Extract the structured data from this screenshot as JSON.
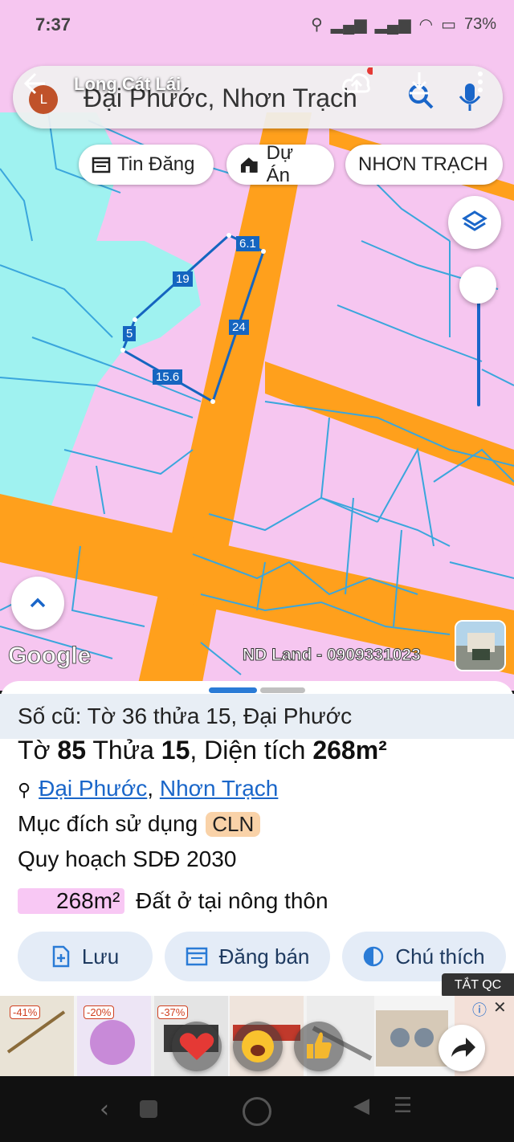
{
  "status_bar": {
    "time": "7:37",
    "battery": "73%"
  },
  "header": {
    "overlay_title": "Long Cát Lái",
    "avatar_letter": "L",
    "search_query": "Đại Phước, Nhơn Trạch"
  },
  "chips": [
    {
      "label": "Tin Đăng",
      "icon": "calendar-icon"
    },
    {
      "label": "Dự Án",
      "icon": "house-icon"
    },
    {
      "label": "NHƠN TRẠCH"
    }
  ],
  "plot_dimensions": [
    "6.1",
    "19",
    "24",
    "5",
    "15.6"
  ],
  "map_labels": {
    "google": "Google",
    "watermark": "ND Land - 0909331023"
  },
  "sheet": {
    "old_parcel": "Số cũ: Tờ 36 thửa 15, Đại Phước",
    "parcel_prefix": "Tờ ",
    "sheet_no": "85",
    "parcel_mid": " Thửa ",
    "parcel_no": "15",
    "area_label": ", Diện tích ",
    "area_value": "268m²",
    "location_ward": "Đại Phước",
    "location_sep": ", ",
    "location_district": "Nhơn Trạch",
    "usage_label": "Mục đích sử dụng",
    "usage_code": "CLN",
    "planning_label": "Quy hoạch SDĐ 2030",
    "planning_area": "268m²",
    "planning_type": "Đất ở tại nông thôn"
  },
  "actions": [
    {
      "label": "Lưu",
      "icon": "add-file-icon"
    },
    {
      "label": "Đăng bán",
      "icon": "list-icon"
    },
    {
      "label": "Chú thích",
      "icon": "contrast-icon"
    }
  ],
  "ads": {
    "tag": "TẮT QC",
    "discounts": [
      "-41%",
      "-20%",
      "-37%"
    ]
  },
  "colors": {
    "residential": "#f6c6f0",
    "road": "#ffa01c",
    "water": "#9ff2f0",
    "boundary": "#3aa6dc",
    "plot": "#1565c0",
    "accent": "#2a7bd6"
  }
}
